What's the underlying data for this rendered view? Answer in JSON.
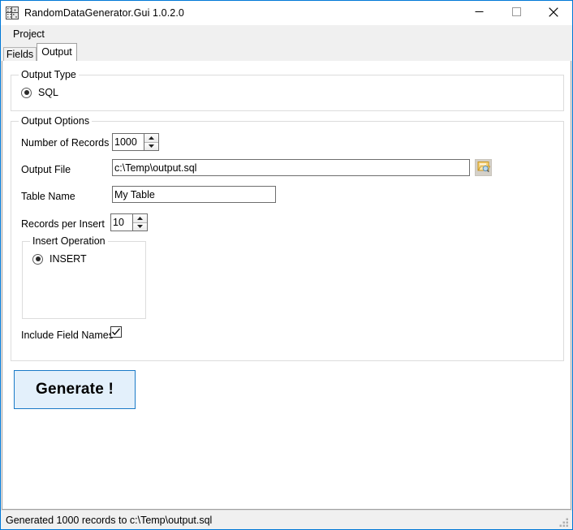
{
  "window": {
    "title": "RandomDataGenerator.Gui 1.0.2.0",
    "app_icon": "dice-app-icon",
    "controls": {
      "minimize": "minimize-icon",
      "maximize": "maximize-icon",
      "close": "close-icon"
    },
    "accent_color": "#0078d7"
  },
  "menubar": {
    "items": [
      {
        "label": "Project"
      }
    ]
  },
  "tabs": [
    {
      "label": "Fields",
      "active": false
    },
    {
      "label": "Output",
      "active": true
    }
  ],
  "output_type": {
    "group_title": "Output Type",
    "options": [
      {
        "label": "SQL",
        "selected": true
      }
    ]
  },
  "output_options": {
    "group_title": "Output Options",
    "number_of_records": {
      "label": "Number of Records",
      "value": "1000"
    },
    "output_file": {
      "label": "Output File",
      "value": "c:\\Temp\\output.sql",
      "placeholder": "",
      "browse_icon": "open-folder-icon"
    },
    "table_name": {
      "label": "Table Name",
      "value": "My Table",
      "placeholder": ""
    },
    "records_per_insert": {
      "label": "Records per Insert",
      "value": "10"
    },
    "insert_operation": {
      "group_title": "Insert Operation",
      "options": [
        {
          "label": "INSERT",
          "selected": true
        }
      ]
    },
    "include_field_names": {
      "label": "Include Field Names",
      "checked": true
    }
  },
  "generate_button": {
    "label": "Generate !",
    "border_color": "#1a7ac7",
    "fill_color": "#e3f0fb"
  },
  "statusbar": {
    "message": "Generated 1000 records to c:\\Temp\\output.sql",
    "grip": "resize-grip-icon"
  }
}
